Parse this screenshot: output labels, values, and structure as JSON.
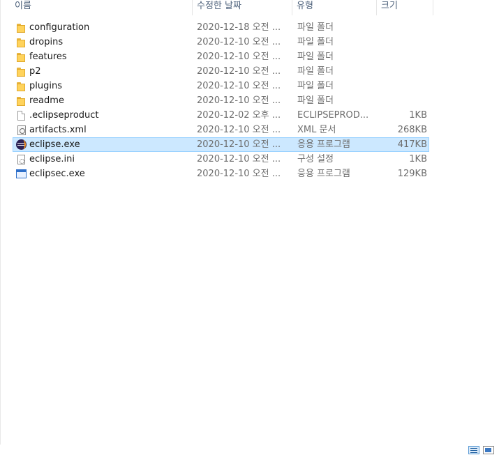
{
  "columns": {
    "name": "이름",
    "date": "수정한 날짜",
    "type": "유형",
    "size": "크기"
  },
  "files": [
    {
      "name": "configuration",
      "date": "2020-12-18 오전 ...",
      "type": "파일 폴더",
      "size": "",
      "icon": "folder-icon"
    },
    {
      "name": "dropins",
      "date": "2020-12-10 오전 ...",
      "type": "파일 폴더",
      "size": "",
      "icon": "folder-icon"
    },
    {
      "name": "features",
      "date": "2020-12-10 오전 ...",
      "type": "파일 폴더",
      "size": "",
      "icon": "folder-icon"
    },
    {
      "name": "p2",
      "date": "2020-12-10 오전 ...",
      "type": "파일 폴더",
      "size": "",
      "icon": "folder-icon"
    },
    {
      "name": "plugins",
      "date": "2020-12-10 오전 ...",
      "type": "파일 폴더",
      "size": "",
      "icon": "folder-icon"
    },
    {
      "name": "readme",
      "date": "2020-12-10 오전 ...",
      "type": "파일 폴더",
      "size": "",
      "icon": "folder-icon"
    },
    {
      "name": ".eclipseproduct",
      "date": "2020-12-02 오후 ...",
      "type": "ECLIPSEPROD...",
      "size": "1KB",
      "icon": "file-icon"
    },
    {
      "name": "artifacts.xml",
      "date": "2020-12-10 오전 ...",
      "type": "XML 문서",
      "size": "268KB",
      "icon": "xml-file-icon"
    },
    {
      "name": "eclipse.exe",
      "date": "2020-12-10 오전 ...",
      "type": "응용 프로그램",
      "size": "417KB",
      "icon": "eclipse-icon",
      "selected": true
    },
    {
      "name": "eclipse.ini",
      "date": "2020-12-10 오전 ...",
      "type": "구성 설정",
      "size": "1KB",
      "icon": "ini-file-icon"
    },
    {
      "name": "eclipsec.exe",
      "date": "2020-12-10 오전 ...",
      "type": "응용 프로그램",
      "size": "129KB",
      "icon": "application-icon"
    }
  ],
  "colors": {
    "selection_bg": "#cce8ff",
    "selection_border": "#99d1ff",
    "header_text": "#4c607a",
    "folder": "#ffd35c"
  }
}
